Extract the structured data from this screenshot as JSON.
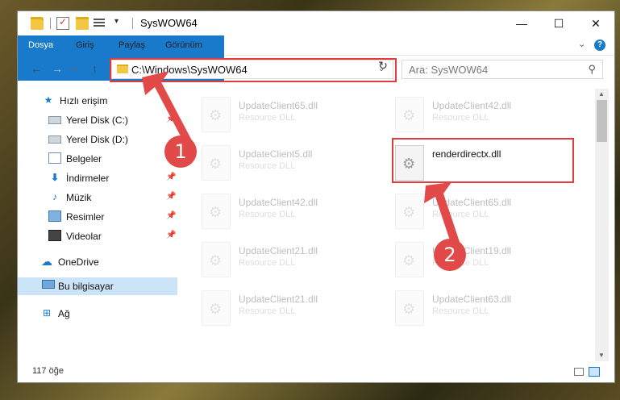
{
  "window": {
    "title": "SysWOW64",
    "minimize_glyph": "—",
    "maximize_glyph": "☐",
    "close_glyph": "✕"
  },
  "ribbon": {
    "tabs": [
      "Dosya",
      "Giriş",
      "Paylaş",
      "Görünüm"
    ],
    "expand_glyph": "⌄",
    "help_glyph": "?"
  },
  "nav": {
    "back_glyph": "←",
    "forward_glyph": "→",
    "recent_glyph": "▾",
    "up_glyph": "↑",
    "address": "C:\\Windows\\SysWOW64",
    "address_dropdown_glyph": "⌄",
    "refresh_glyph": "↻",
    "search_placeholder": "Ara: SysWOW64",
    "search_glyph": "⚲"
  },
  "sidebar": {
    "items": [
      {
        "label": "Hızlı erişim",
        "icon": "star-icon",
        "glyph": "★"
      },
      {
        "label": "Yerel Disk (C:)",
        "icon": "drive-icon",
        "pinned": true
      },
      {
        "label": "Yerel Disk (D:)",
        "icon": "drive-icon"
      },
      {
        "label": "Belgeler",
        "icon": "documents-icon",
        "pinned": true
      },
      {
        "label": "İndirmeler",
        "icon": "downloads-icon",
        "glyph": "⬇",
        "pinned": true
      },
      {
        "label": "Müzik",
        "icon": "music-icon",
        "glyph": "♪",
        "pinned": true
      },
      {
        "label": "Resimler",
        "icon": "pictures-icon",
        "pinned": true
      },
      {
        "label": "Videolar",
        "icon": "videos-icon",
        "pinned": true
      },
      {
        "label": "OneDrive",
        "icon": "onedrive-icon",
        "glyph": "☁"
      },
      {
        "label": "Bu bilgisayar",
        "icon": "this-pc-icon",
        "selected": true
      },
      {
        "label": "Ağ",
        "icon": "network-icon",
        "glyph": "⊞"
      }
    ],
    "pin_glyph": "📌"
  },
  "files": [
    {
      "name": "UpdateClient65.dll",
      "type": "Resource DLL",
      "faded": true
    },
    {
      "name": "UpdateClient42.dll",
      "type": "Resource DLL",
      "faded": true
    },
    {
      "name": "UpdateClient5.dll",
      "type": "Resource DLL",
      "faded": true
    },
    {
      "name": "renderdirectx.dll",
      "type": "",
      "faded": false,
      "highlighted": true
    },
    {
      "name": "UpdateClient42.dll",
      "type": "Resource DLL",
      "faded": true
    },
    {
      "name": "UpdateClient65.dll",
      "type": "Resource DLL",
      "faded": true
    },
    {
      "name": "UpdateClient21.dll",
      "type": "Resource DLL",
      "faded": true
    },
    {
      "name": "UpdateClient19.dll",
      "type": "Resource DLL",
      "faded": true
    },
    {
      "name": "UpdateClient21.dll",
      "type": "Resource DLL",
      "faded": true
    },
    {
      "name": "UpdateClient63.dll",
      "type": "Resource DLL",
      "faded": true
    }
  ],
  "status": {
    "item_count": "117 öğe"
  },
  "scrollbar": {
    "up_glyph": "▲",
    "down_glyph": "▼"
  },
  "annotations": {
    "step1": "1",
    "step2": "2",
    "highlight_color": "#e23b3b"
  }
}
